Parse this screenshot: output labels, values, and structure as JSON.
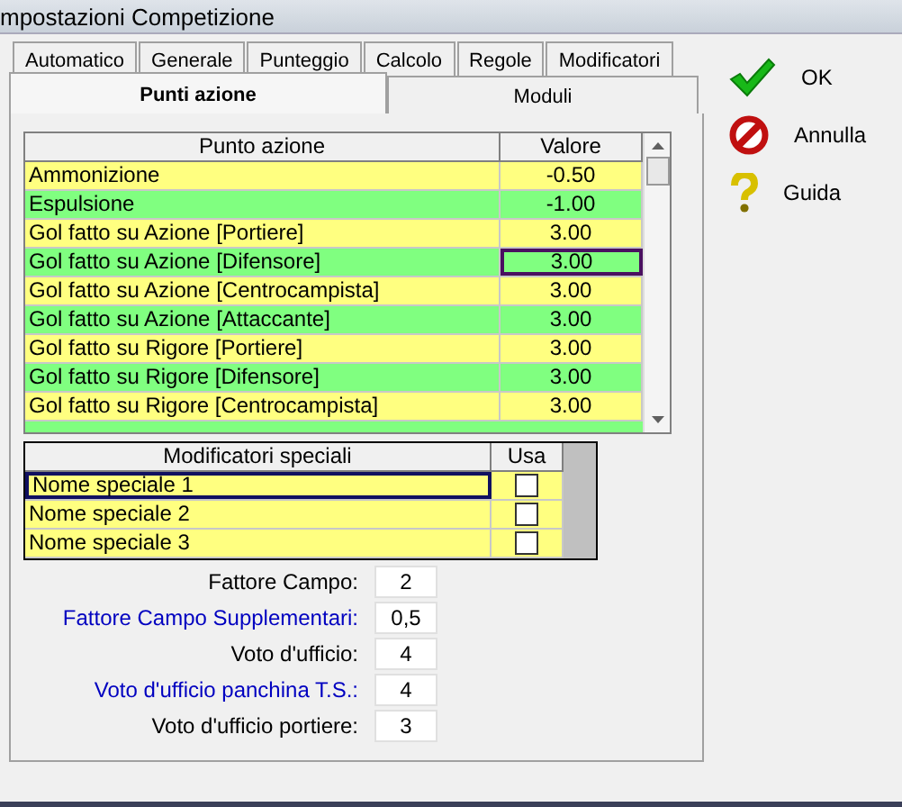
{
  "window": {
    "title": "mpostazioni Competizione"
  },
  "tabs_row_1": [
    {
      "label": "Automatico",
      "selected": false
    },
    {
      "label": "Generale",
      "selected": false
    },
    {
      "label": "Punteggio",
      "selected": false
    },
    {
      "label": "Calcolo",
      "selected": false
    },
    {
      "label": "Regole",
      "selected": false
    },
    {
      "label": "Modificatori",
      "selected": false
    }
  ],
  "tabs_row_2": [
    {
      "label": "Punti azione",
      "selected": true
    },
    {
      "label": "Moduli",
      "selected": false
    }
  ],
  "points_table": {
    "columns": [
      "Punto azione",
      "Valore"
    ],
    "rows": [
      {
        "name": "Ammonizione",
        "value": "-0.50",
        "selected": false
      },
      {
        "name": "Espulsione",
        "value": "-1.00",
        "selected": false
      },
      {
        "name": "Gol fatto su Azione [Portiere]",
        "value": "3.00",
        "selected": false
      },
      {
        "name": "Gol fatto su Azione [Difensore]",
        "value": "3.00",
        "selected": true
      },
      {
        "name": "Gol fatto su Azione [Centrocampista]",
        "value": "3.00",
        "selected": false
      },
      {
        "name": "Gol fatto su Azione [Attaccante]",
        "value": "3.00",
        "selected": false
      },
      {
        "name": "Gol fatto su Rigore [Portiere]",
        "value": "3.00",
        "selected": false
      },
      {
        "name": "Gol fatto su Rigore [Difensore]",
        "value": "3.00",
        "selected": false
      },
      {
        "name": "Gol fatto su Rigore [Centrocampista]",
        "value": "3.00",
        "selected": false
      }
    ]
  },
  "modifiers_table": {
    "columns": [
      "Modificatori speciali",
      "Usa"
    ],
    "rows": [
      {
        "name": "Nome speciale 1",
        "checked": false,
        "selected": true
      },
      {
        "name": "Nome speciale 2",
        "checked": false,
        "selected": false
      },
      {
        "name": "Nome speciale 3",
        "checked": false,
        "selected": false
      }
    ]
  },
  "fields": [
    {
      "label": "Fattore Campo:",
      "value": "2",
      "highlighted": false
    },
    {
      "label": "Fattore Campo Supplementari:",
      "value": "0,5",
      "highlighted": true
    },
    {
      "label": "Voto d'ufficio:",
      "value": "4",
      "highlighted": false
    },
    {
      "label": "Voto d'ufficio panchina T.S.:",
      "value": "4",
      "highlighted": true
    },
    {
      "label": "Voto d'ufficio portiere:",
      "value": "3",
      "highlighted": false
    }
  ],
  "buttons": [
    {
      "kind": "ok",
      "label": "OK"
    },
    {
      "kind": "cancel",
      "label": "Annulla"
    },
    {
      "kind": "help",
      "label": "Guida"
    }
  ]
}
